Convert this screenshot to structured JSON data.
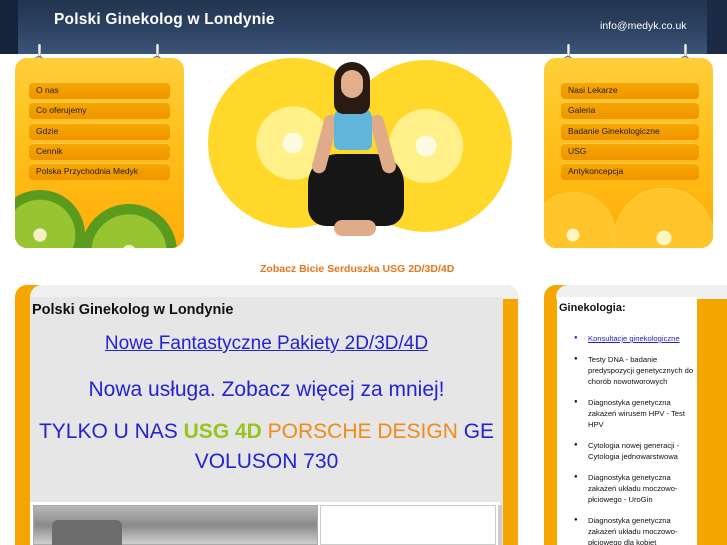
{
  "header": {
    "title": "Polski Ginekolog w Londynie",
    "email": "info@medyk.co.uk"
  },
  "left_menu": {
    "items": [
      "O nas",
      "Co oferujemy",
      "Gdzie",
      "Cennik",
      "Polska Przychodnia Medyk"
    ]
  },
  "right_menu": {
    "items": [
      "Nasi Lekarze",
      "Galeria",
      "Badanie Ginekologiczne",
      "USG",
      "Antykoncepcja"
    ]
  },
  "hero": {
    "caption": "Zobacz Bicie Serduszka USG 2D/3D/4D"
  },
  "main": {
    "title": "Polski Ginekolog w Londynie",
    "packages_link": "Nowe Fantastyczne Pakiety 2D/3D/4D ",
    "new_service": "Nowa usługa. Zobacz więcej za mniej!",
    "promo_part1": "TYLKO U NAS ",
    "promo_usg4d": "USG 4D",
    "promo_porsche": " PORSCHE DESIGN",
    "promo_part2": " GE VOLUSON 730"
  },
  "sidebar": {
    "title": "Ginekologia:",
    "items": [
      "Konsultacje ginekologiczne",
      "Testy DNA - badanie predyspozycji genetycznych do chorób nowotworowych",
      "Diagnostyka genetyczna zakażeń wirusem HPV - Test HPV",
      "Cytologia nowej generacji - Cytologia jednowarstwowa",
      "Diagnostyka genetyczna zakażeń układu moczowo-płciowego - UroGin",
      "Diagnostyka genetyczna zakażeń układu moczowo-płciowego dla kobiet"
    ]
  },
  "colors": {
    "header_bg": "#2d4363",
    "accent_orange": "#f6a600",
    "menu_item": "#f7a800",
    "link_blue": "#2323d6",
    "usg_green": "#98c41e",
    "porsche_orange": "#f08a1a"
  },
  "icons": [
    "pin-icon",
    "bullet-icon"
  ]
}
